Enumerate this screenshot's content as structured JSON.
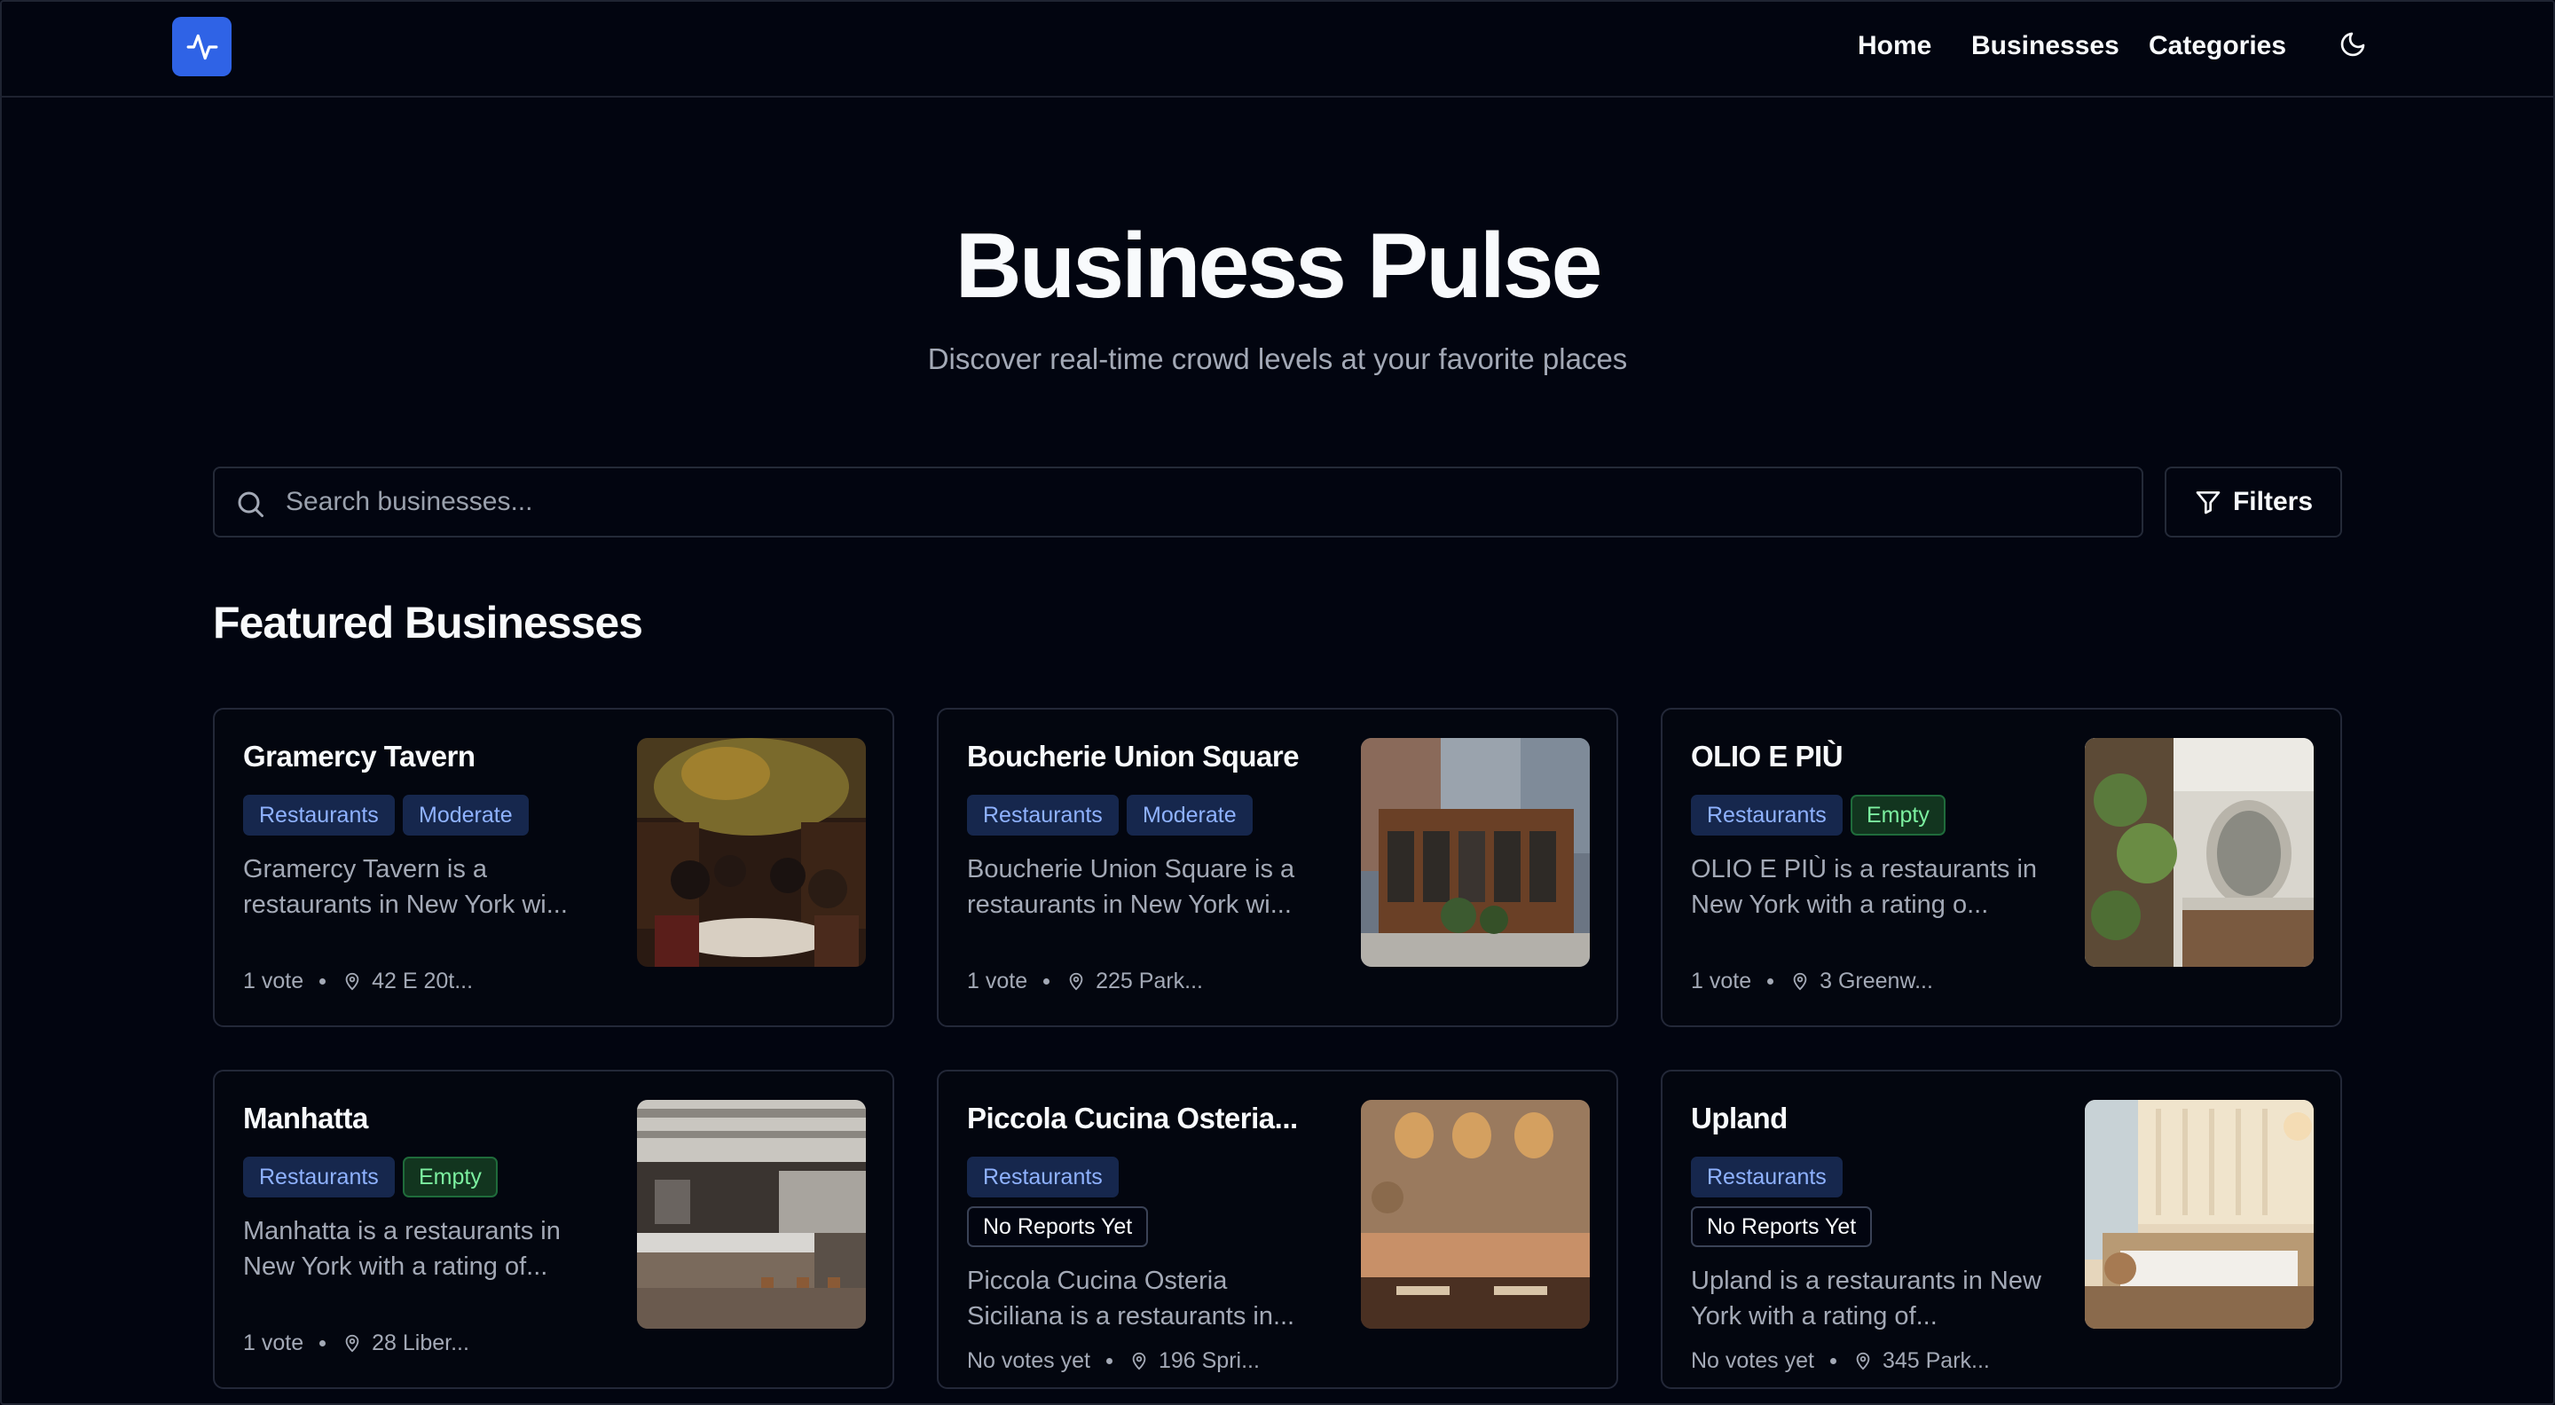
{
  "header": {
    "nav": {
      "home": "Home",
      "businesses": "Businesses",
      "categories": "Categories"
    },
    "icons": {
      "logo": "activity-pulse-icon",
      "theme_toggle": "moon-icon"
    },
    "accent_color": "#2f63e6"
  },
  "hero": {
    "title": "Business Pulse",
    "subtitle": "Discover real-time crowd levels at your favorite places"
  },
  "search": {
    "placeholder": "Search businesses...",
    "value": "",
    "filters_label": "Filters"
  },
  "featured": {
    "title": "Featured Businesses",
    "cards": [
      {
        "name": "Gramercy Tavern",
        "category": "Restaurants",
        "status": "Moderate",
        "description": "Gramercy Tavern is a restaurants in New York wi...",
        "votes": "1 vote",
        "address": "42 E 20t..."
      },
      {
        "name": "Boucherie Union Square",
        "category": "Restaurants",
        "status": "Moderate",
        "description": "Boucherie Union Square is a restaurants in New York wi...",
        "votes": "1 vote",
        "address": "225 Park..."
      },
      {
        "name": "OLIO E PIÙ",
        "category": "Restaurants",
        "status": "Empty",
        "description": "OLIO E PIÙ is a restaurants in New York with a rating o...",
        "votes": "1 vote",
        "address": "3 Greenw..."
      },
      {
        "name": "Manhatta",
        "category": "Restaurants",
        "status": "Empty",
        "description": "Manhatta is a restaurants in New York with a rating of...",
        "votes": "1 vote",
        "address": "28 Liber..."
      },
      {
        "name": "Piccola Cucina Osteria...",
        "category": "Restaurants",
        "status": "No Reports Yet",
        "description": "Piccola Cucina Osteria Siciliana is a restaurants in...",
        "votes": "No votes yet",
        "address": "196 Spri..."
      },
      {
        "name": "Upland",
        "category": "Restaurants",
        "status": "No Reports Yet",
        "description": "Upland is a restaurants in New York with a rating of...",
        "votes": "No votes yet",
        "address": "345 Park..."
      }
    ]
  },
  "status_colors": {
    "moderate": "#8fb2ff",
    "empty": "#7cf0a0",
    "no_reports": "#f8fafc"
  }
}
